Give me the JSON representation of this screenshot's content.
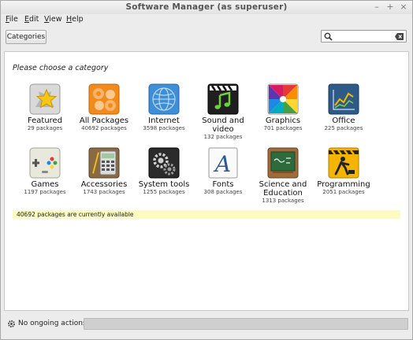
{
  "window": {
    "title": "Software Manager (as superuser)"
  },
  "menu": [
    {
      "mnemonic": "F",
      "rest": "ile"
    },
    {
      "mnemonic": "E",
      "rest": "dit"
    },
    {
      "mnemonic": "V",
      "rest": "iew"
    },
    {
      "mnemonic": "H",
      "rest": "elp"
    }
  ],
  "toolbar": {
    "categories_label": "Categories"
  },
  "search": {
    "value": "",
    "placeholder": ""
  },
  "main": {
    "prompt": "Please choose a category",
    "categories": [
      {
        "name": "Featured",
        "count": "29 packages",
        "icon": "star-icon"
      },
      {
        "name": "All Packages",
        "count": "40692 packages",
        "icon": "packages-icon"
      },
      {
        "name": "Internet",
        "count": "3598 packages",
        "icon": "globe-icon"
      },
      {
        "name_line1": "Sound and",
        "name_line2": "video",
        "count": "132 packages",
        "icon": "music-video-icon"
      },
      {
        "name": "Graphics",
        "count": "701 packages",
        "icon": "color-wheel-icon"
      },
      {
        "name": "Office",
        "count": "225 packages",
        "icon": "chart-icon"
      },
      {
        "name": "Games",
        "count": "1197 packages",
        "icon": "gamepad-icon"
      },
      {
        "name": "Accessories",
        "count": "1743 packages",
        "icon": "calculator-icon"
      },
      {
        "name": "System tools",
        "count": "1255 packages",
        "icon": "gears-icon"
      },
      {
        "name": "Fonts",
        "count": "308 packages",
        "icon": "font-icon"
      },
      {
        "name_line1": "Science and",
        "name_line2": "Education",
        "count": "1313 packages",
        "icon": "chalkboard-icon"
      },
      {
        "name": "Programming",
        "count": "2051 packages",
        "icon": "construction-icon"
      }
    ],
    "status": "40692 packages are currently available"
  },
  "statusbar": {
    "actions": "No ongoing actions",
    "progress": 0
  }
}
